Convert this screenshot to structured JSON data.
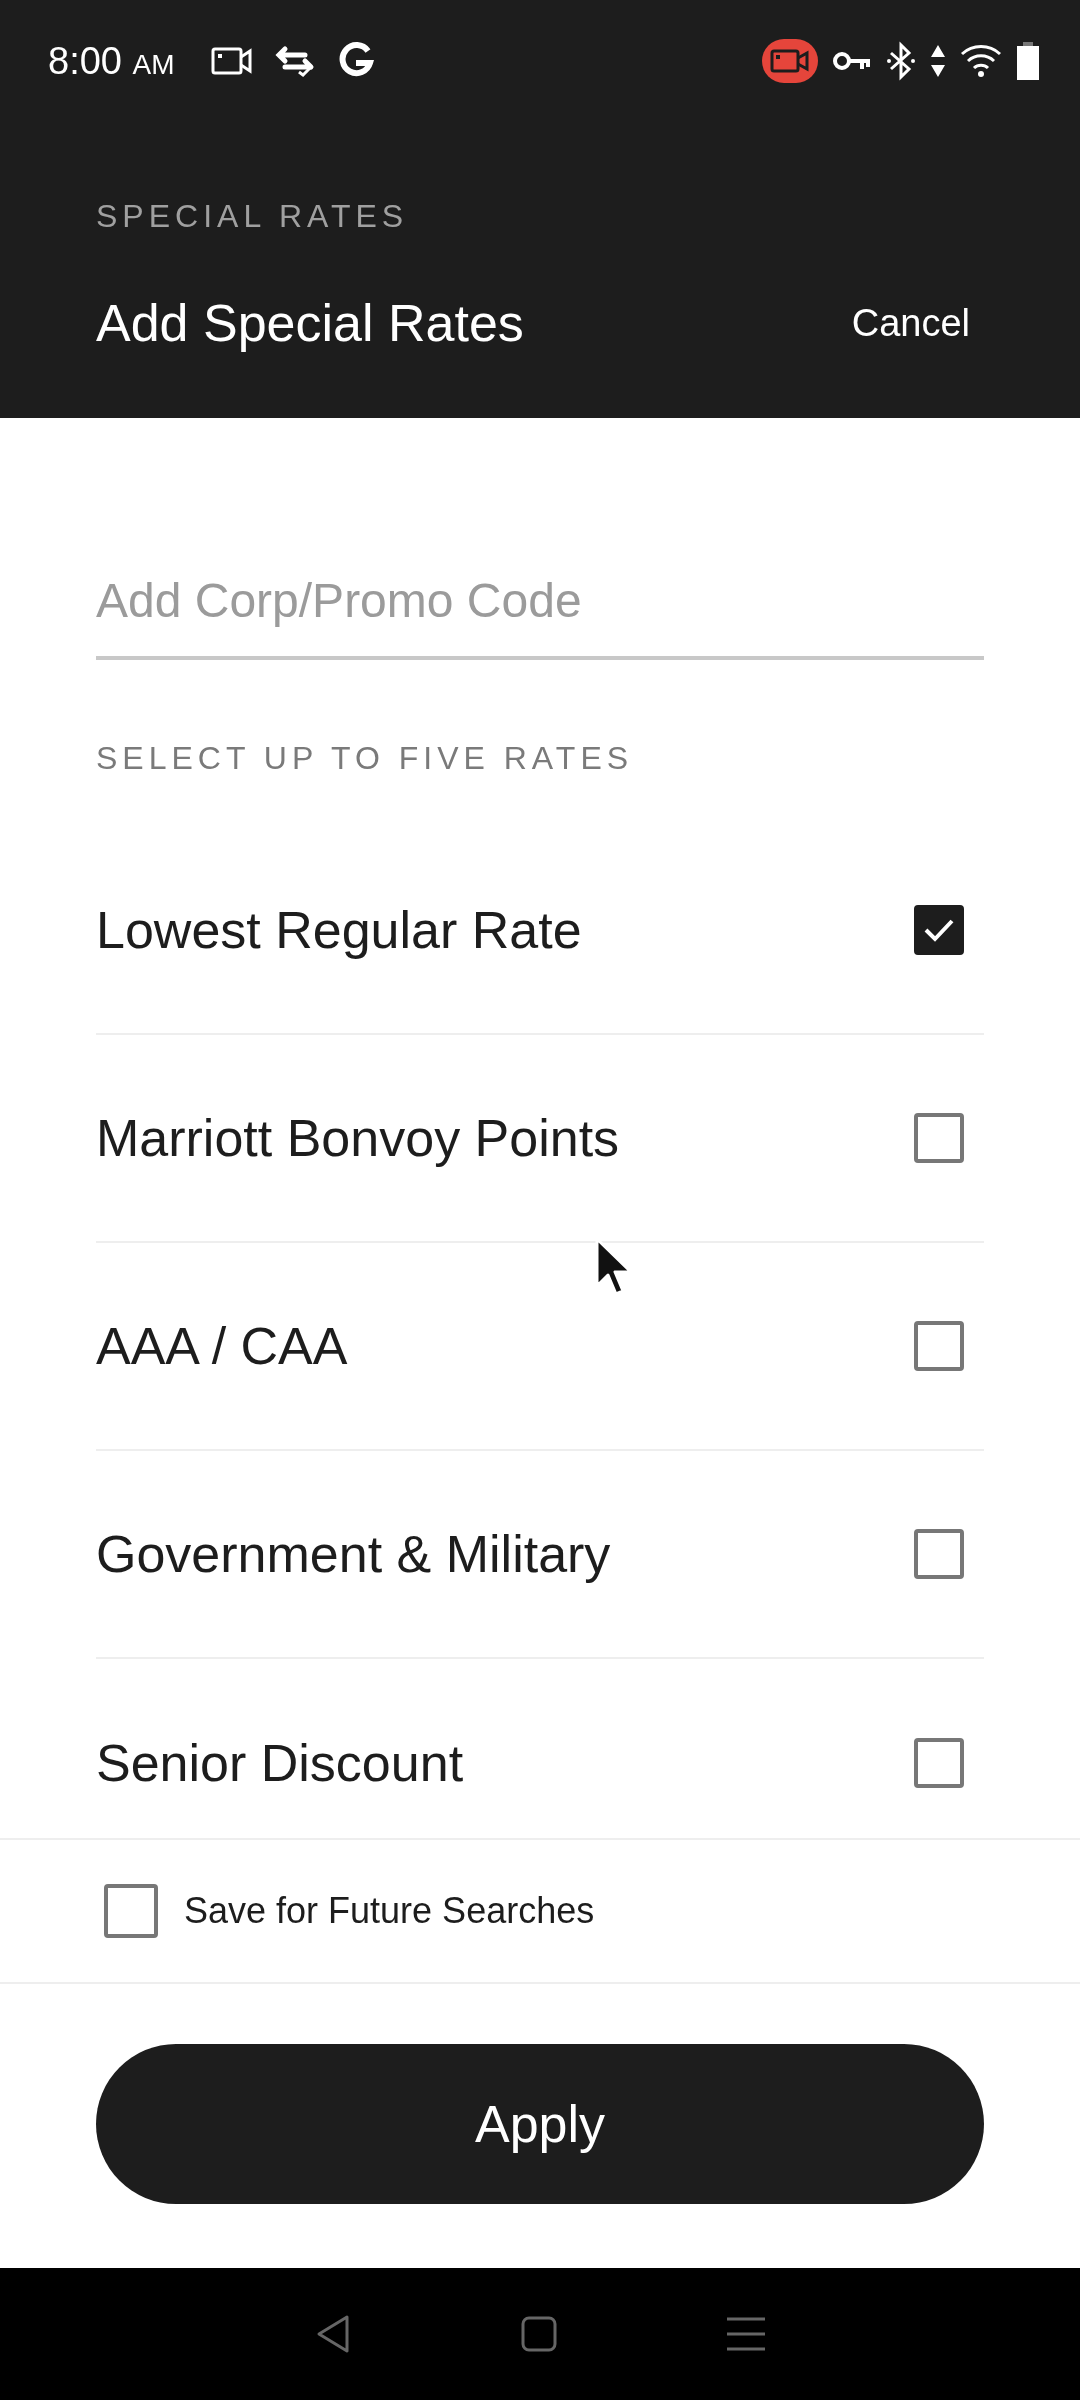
{
  "status_bar": {
    "time": "8:00",
    "meridiem": "AM"
  },
  "header": {
    "eyebrow": "SPECIAL RATES",
    "title": "Add Special Rates",
    "cancel": "Cancel"
  },
  "code_field": {
    "placeholder": "Add Corp/Promo Code"
  },
  "section_label": "SELECT UP TO FIVE RATES",
  "rates": [
    {
      "label": "Lowest Regular Rate",
      "checked": true
    },
    {
      "label": "Marriott Bonvoy Points",
      "checked": false
    },
    {
      "label": "AAA / CAA",
      "checked": false
    },
    {
      "label": "Government & Military",
      "checked": false
    },
    {
      "label": "Senior Discount",
      "checked": false
    }
  ],
  "save_option": {
    "label": "Save for Future Searches",
    "checked": false
  },
  "apply_button": "Apply"
}
